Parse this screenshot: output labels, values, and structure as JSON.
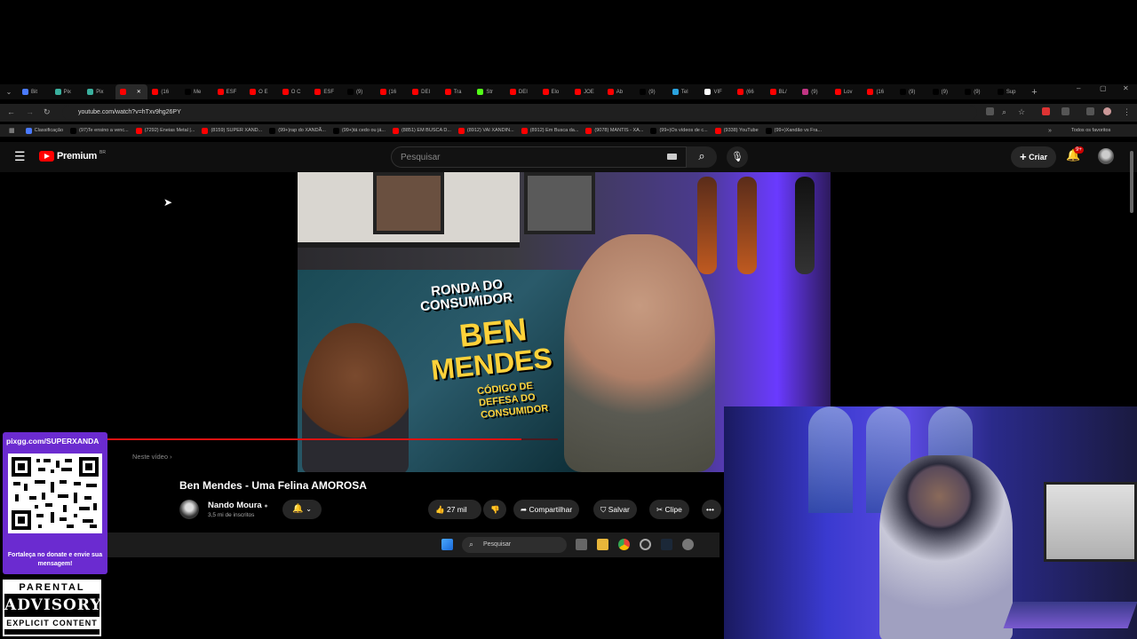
{
  "browser": {
    "tabs": [
      {
        "label": "Bit",
        "color": "#4a7aff"
      },
      {
        "label": "Pix",
        "color": "#3ab09e"
      },
      {
        "label": "Pix",
        "color": "#3ab09e"
      },
      {
        "label": "",
        "color": "#ff0000",
        "active": true
      },
      {
        "label": "(16",
        "color": "#ff0000"
      },
      {
        "label": "Me",
        "color": "#000000"
      },
      {
        "label": "ESF",
        "color": "#ff0000"
      },
      {
        "label": "O E",
        "color": "#ff0000"
      },
      {
        "label": "O C",
        "color": "#ff0000"
      },
      {
        "label": "ESF",
        "color": "#ff0000"
      },
      {
        "label": "(9)",
        "color": "#000000"
      },
      {
        "label": "(16",
        "color": "#ff0000"
      },
      {
        "label": "DEI",
        "color": "#ff0000"
      },
      {
        "label": "Tra",
        "color": "#ff0000"
      },
      {
        "label": "Str",
        "color": "#53fc18"
      },
      {
        "label": "DEI",
        "color": "#ff0000"
      },
      {
        "label": "Elo",
        "color": "#ff0000"
      },
      {
        "label": "JOE",
        "color": "#ff0000"
      },
      {
        "label": "Ab",
        "color": "#ff0000"
      },
      {
        "label": "(9)",
        "color": "#000000"
      },
      {
        "label": "Tel",
        "color": "#2aa3df"
      },
      {
        "label": "VIF",
        "color": "#ffffff"
      },
      {
        "label": "(66",
        "color": "#ff0000"
      },
      {
        "label": "BL/",
        "color": "#ff0000"
      },
      {
        "label": "(9)",
        "color": "#c13584"
      },
      {
        "label": "Lov",
        "color": "#ff0000"
      },
      {
        "label": "(16",
        "color": "#ff0000"
      },
      {
        "label": "(9)",
        "color": "#000000"
      },
      {
        "label": "(9)",
        "color": "#000000"
      },
      {
        "label": "(9)",
        "color": "#000000"
      },
      {
        "label": "Sup",
        "color": "#000000"
      }
    ],
    "url": "youtube.com/watch?v=hTxv9hg26PY",
    "bookmarks": [
      {
        "label": "Classificação",
        "color": "#4a7aff"
      },
      {
        "label": "(97)Te ensino a venc...",
        "color": "#000000"
      },
      {
        "label": "(7292) Eneias Metal |...",
        "color": "#ff0000"
      },
      {
        "label": "(8159) SUPER XAND...",
        "color": "#ff0000"
      },
      {
        "label": "(99+)rap do XANDÃ...",
        "color": "#000000"
      },
      {
        "label": "(99+)tá cedo ou já...",
        "color": "#000000"
      },
      {
        "label": "(8851) EM BUSCA D...",
        "color": "#ff0000"
      },
      {
        "label": "(8912) VAI XANDIN...",
        "color": "#ff0000"
      },
      {
        "label": "(8912) Em Busca da...",
        "color": "#ff0000"
      },
      {
        "label": "(9078) MANTIS - XA...",
        "color": "#ff0000"
      },
      {
        "label": "(99+)Os vídeos de c...",
        "color": "#000000"
      },
      {
        "label": "(9338) YouTube",
        "color": "#ff0000"
      },
      {
        "label": "(99+)Xandão vs Fra...",
        "color": "#000000"
      }
    ],
    "all_bookmarks": "Todos os favoritos"
  },
  "youtube": {
    "logo": "Premium",
    "logo_country": "BR",
    "search_placeholder": "Pesquisar",
    "create_label": "Criar",
    "notif_badge": "9+",
    "video_title": "Ben Mendes - Uma Felina AMOROSA",
    "channel_name": "Nando Moura",
    "channel_subs": "3,5 mi de inscritos",
    "likes": "27 mil",
    "share": "Compartilhar",
    "save": "Salvar",
    "clip": "Clipe",
    "in_this_video": "Neste vídeo",
    "thumb_texts": [
      "RONDA DO",
      "CONSUMIDOR",
      "BEN",
      "MENDES",
      "CÓDIGO DE",
      "DEFESA DO",
      "CONSUMIDOR"
    ],
    "progress": 0.92
  },
  "taskbar": {
    "search": "Pesquisar"
  },
  "overlay": {
    "donate_url": "pixgg.com/SUPERXANDA",
    "donate_msg": "Fortaleça no donate e envie sua mensagem!",
    "pa_top": "PARENTAL",
    "pa_mid": "ADVISORY",
    "pa_bot": "EXPLICIT CONTENT"
  }
}
